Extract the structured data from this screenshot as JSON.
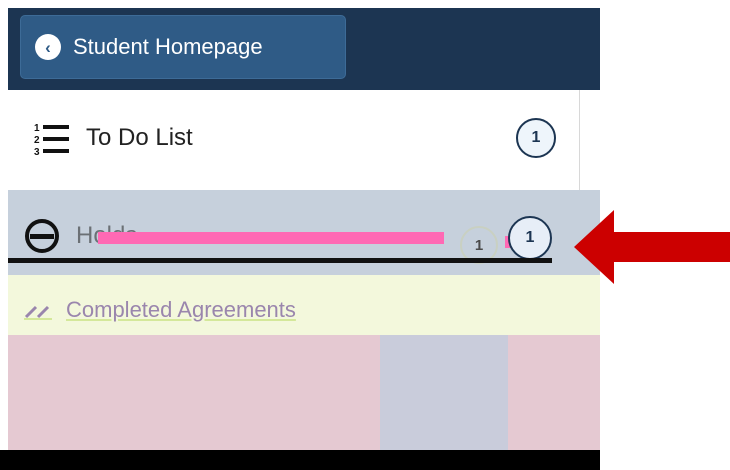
{
  "header": {
    "back_label": "Student Homepage",
    "back_icon": "chevron-left-icon"
  },
  "nav": {
    "items": [
      {
        "label": "To Do List",
        "icon": "ordered-list-icon",
        "count": "1"
      },
      {
        "label": "Holds",
        "icon": "hand-icon",
        "count": "1",
        "secondary_count": "1"
      },
      {
        "label": "Completed Agreements",
        "icon": "edit-icon"
      }
    ]
  },
  "annotation": {
    "arrow_color": "#cc0000",
    "points_to": "Holds"
  },
  "colors": {
    "header": "#1c3552",
    "button": "#2f5b86",
    "active_band": "#c6d0dc",
    "badge_border": "#1c3552"
  }
}
